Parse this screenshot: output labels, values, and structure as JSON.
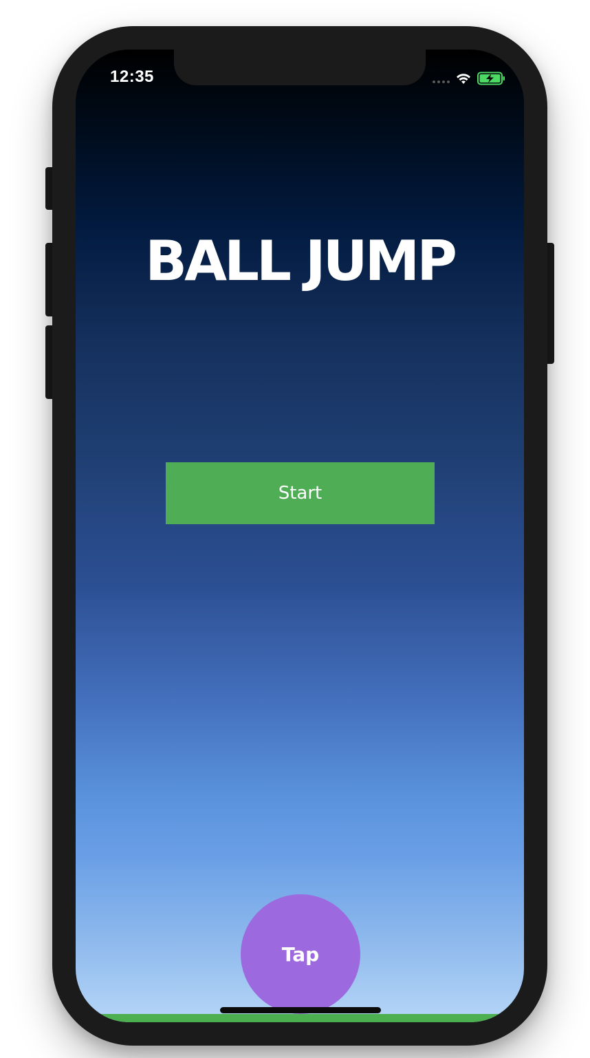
{
  "status_bar": {
    "time": "12:35",
    "wifi_icon": "wifi-icon",
    "battery_icon": "battery-charging-icon",
    "battery_color": "#4cd964"
  },
  "game": {
    "title": "BALL JUMP",
    "start_label": "Start",
    "tap_label": "Tap"
  },
  "colors": {
    "start_button": "#4fae55",
    "ball": "#9c6ade",
    "ground": "#4caf50"
  }
}
